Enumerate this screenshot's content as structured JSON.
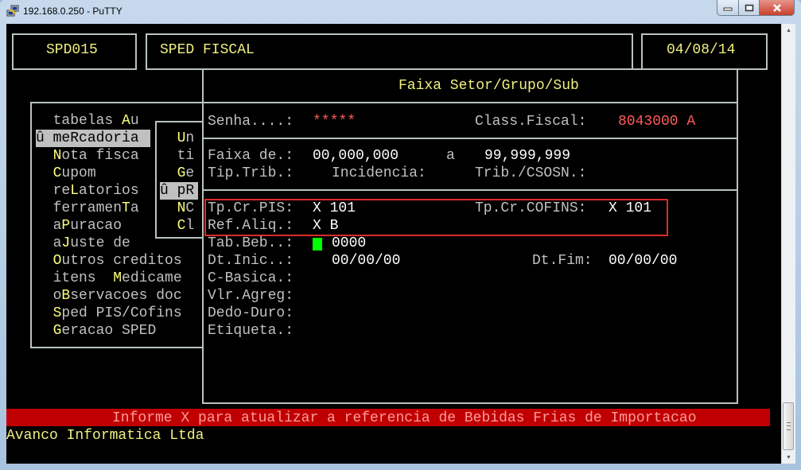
{
  "window": {
    "title": "192.168.0.250 - PuTTY",
    "minimize_glyph": "–",
    "maximize_glyph": "□",
    "close_glyph": "✕"
  },
  "header": {
    "program_code": "SPD015",
    "program_name": "SPED FISCAL",
    "date": "04/08/14"
  },
  "main_menu": {
    "items": [
      {
        "pre": "  tabelas ",
        "hot": "A",
        "post": "u",
        "selected": false
      },
      {
        "pre": "û me",
        "hot": "R",
        "post": "cadoria",
        "selected": true
      },
      {
        "pre": "  ",
        "hot": "N",
        "post": "ota fisca",
        "selected": false
      },
      {
        "pre": "  ",
        "hot": "C",
        "post": "upom",
        "selected": false
      },
      {
        "pre": "  re",
        "hot": "L",
        "post": "atorios",
        "selected": false
      },
      {
        "pre": "  ferramen",
        "hot": "T",
        "post": "a",
        "selected": false
      },
      {
        "pre": "  a",
        "hot": "P",
        "post": "uracao",
        "selected": false
      },
      {
        "pre": "  a",
        "hot": "J",
        "post": "uste de",
        "selected": false
      },
      {
        "pre": "  ",
        "hot": "O",
        "post": "utros creditos",
        "selected": false
      },
      {
        "pre": "  itens  ",
        "hot": "M",
        "post": "edicame",
        "selected": false
      },
      {
        "pre": "  o",
        "hot": "B",
        "post": "servacoes doc",
        "selected": false
      },
      {
        "pre": "  ",
        "hot": "S",
        "post": "ped PIS/Cofins",
        "selected": false
      },
      {
        "pre": "  ",
        "hot": "G",
        "post": "eracao SPED",
        "selected": false
      }
    ]
  },
  "sub_menu": {
    "items": [
      {
        "pre": "  ",
        "hot": "U",
        "post": "n",
        "selected": false
      },
      {
        "pre": "  ",
        "hot": "",
        "post": "ti",
        "selected": false
      },
      {
        "pre": "  ",
        "hot": "G",
        "post": "e",
        "selected": false
      },
      {
        "pre": "û p",
        "hot": "R",
        "post": "",
        "selected": true
      },
      {
        "pre": "  ",
        "hot": "N",
        "post": "C",
        "selected": false
      },
      {
        "pre": "  ",
        "hot": "C",
        "post": "l",
        "selected": false
      }
    ]
  },
  "form": {
    "title": "Faixa Setor/Grupo/Sub",
    "senha_label": "Senha....:",
    "senha_value": "*****",
    "class_fiscal_label": "Class.Fiscal:",
    "class_fiscal_value": "8043000 A",
    "faixa_label": "Faixa de.:",
    "faixa_from": "00,000,000",
    "faixa_sep": "a",
    "faixa_to": "99,999,999",
    "tip_trib_label": "Tip.Trib.:",
    "incidencia_label": "Incidencia:",
    "trib_csosn_label": "Trib./CSOSN.:",
    "tp_cr_pis_label": "Tp.Cr.PIS:",
    "tp_cr_pis_value": "X 101",
    "tp_cr_cofins_label": "Tp.Cr.COFINS:",
    "tp_cr_cofins_value": "X 101",
    "ref_aliq_label": "Ref.Aliq.:",
    "ref_aliq_value": "X B",
    "tab_beb_label": "Tab.Beb..:",
    "tab_beb_value": "0000",
    "dt_inic_label": "Dt.Inic..:",
    "dt_inic_value": "00/00/00",
    "dt_fim_label": "Dt.Fim:",
    "dt_fim_value": "00/00/00",
    "c_basica_label": "C-Basica.:",
    "vlr_agreg_label": "Vlr.Agreg:",
    "dedo_duro_label": "Dedo-Duro:",
    "etiqueta_label": "Etiqueta.:"
  },
  "status": {
    "message": "Informe X para atualizar a referencia de Bebidas Frias de Importacao",
    "company": "Avanco Informatica Ltda"
  },
  "colors": {
    "terminal_bg": "#000000",
    "text_default": "#c0c0c0",
    "hotkey": "#ffff7f",
    "value_red": "#ff5b5b",
    "cursor": "#00ff00",
    "message_bar": "#c00000",
    "annotation_box": "#dc2a2a"
  }
}
